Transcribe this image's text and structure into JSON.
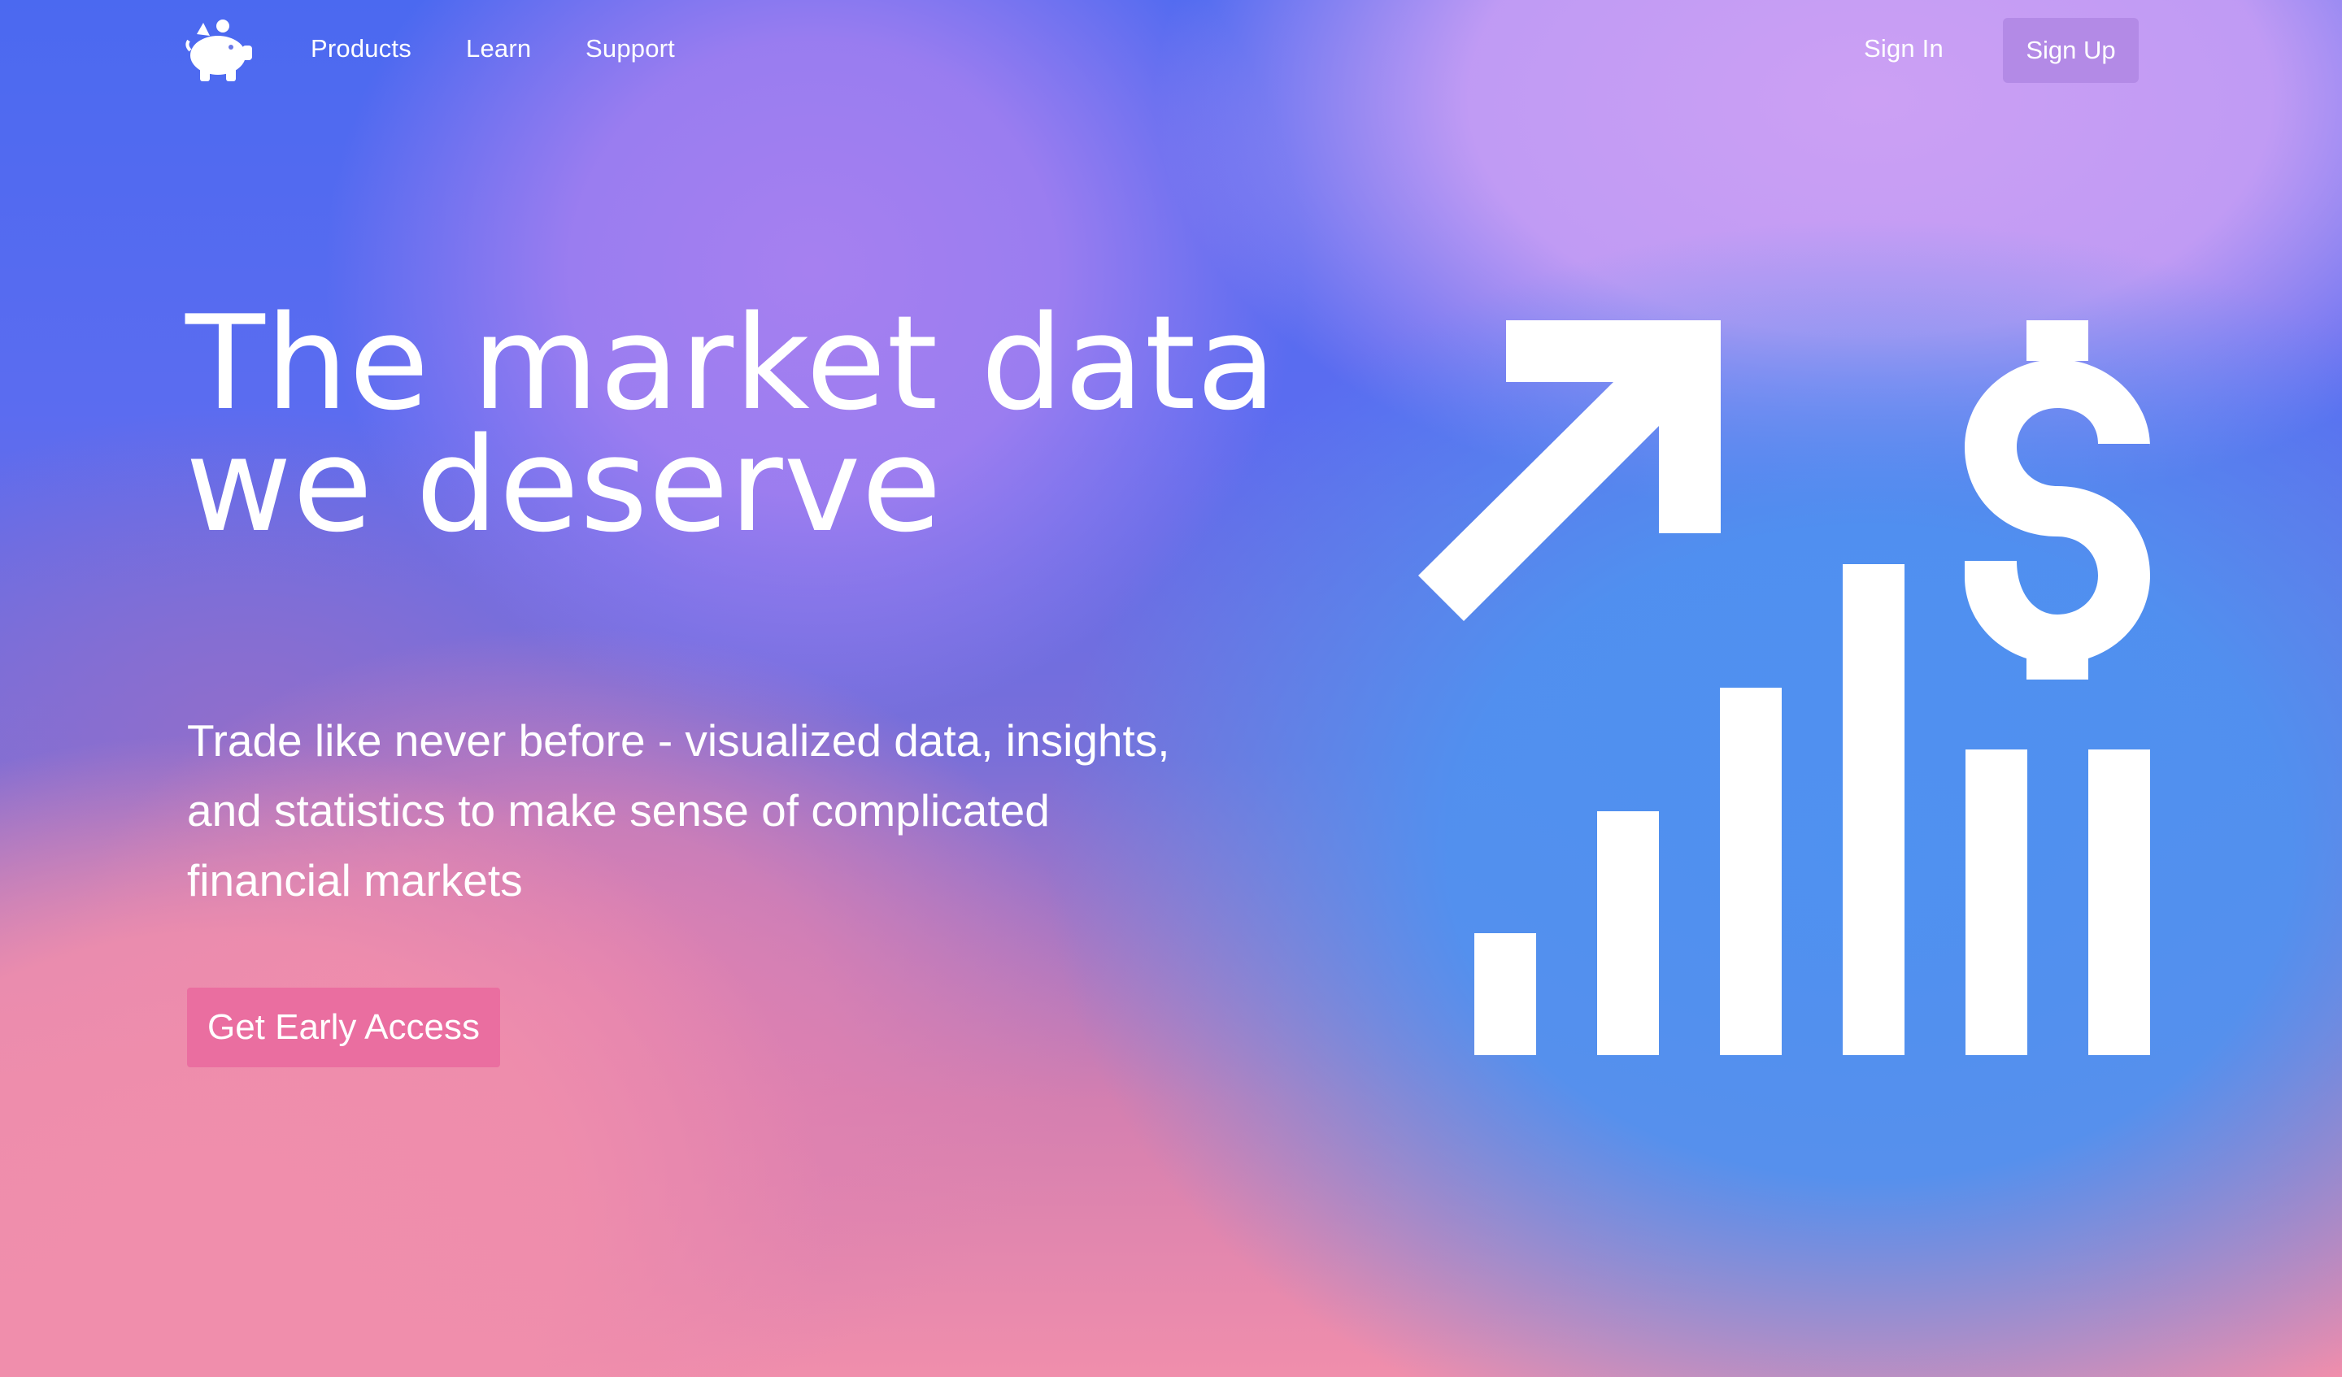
{
  "nav": {
    "logo_icon": "piggy-bank-icon",
    "links": [
      "Products",
      "Learn",
      "Support"
    ],
    "sign_in": "Sign In",
    "sign_up": "Sign Up"
  },
  "hero": {
    "headline_line1": "The market data",
    "headline_line2": "we deserve",
    "subtext": "Trade like never before - visualized data, insights, and statistics to make sense of complicated financial markets",
    "cta": "Get Early Access",
    "illustration_icon": "growth-chart-dollar-icon"
  },
  "colors": {
    "signup_bg": "#b38ae6",
    "cta_bg": "#ea6ea0",
    "blue": "#4f8cef",
    "purple": "#a680f0",
    "pink": "#f08eac"
  }
}
